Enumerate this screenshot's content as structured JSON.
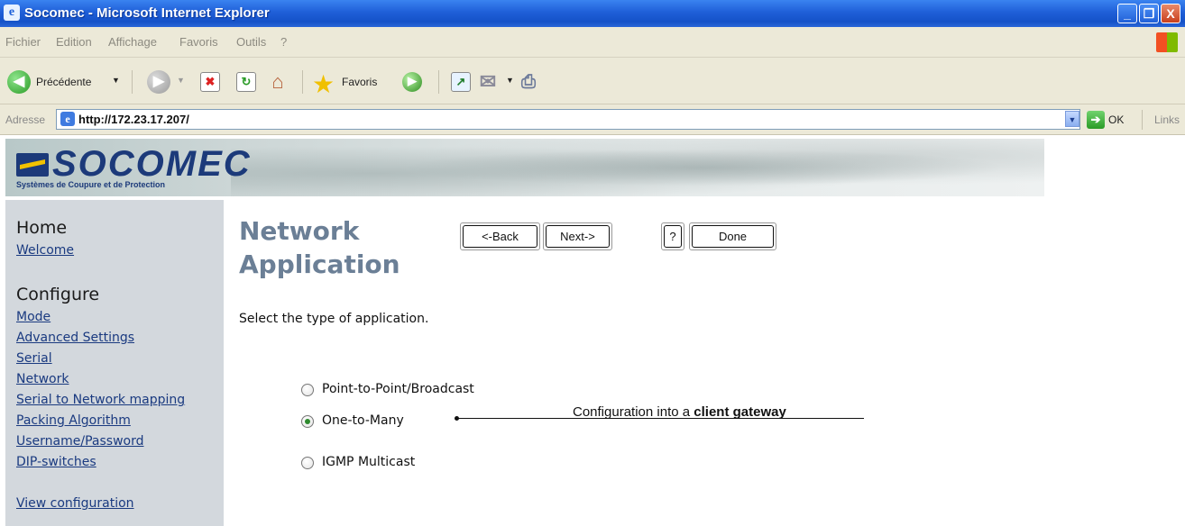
{
  "window": {
    "title": "Socomec - Microsoft Internet Explorer",
    "min_glyph": "_",
    "max_glyph": "❐",
    "close_glyph": "X"
  },
  "menu": [
    "Fichier",
    "Edition",
    "Affichage",
    "Favoris",
    "Outils",
    "?"
  ],
  "toolbar": {
    "back_label": "Précédente",
    "favorites_label": "Favoris",
    "icons": [
      "back-arrow-icon",
      "forward-arrow-icon",
      "stop-icon",
      "refresh-icon",
      "home-icon",
      "favorites-star-icon",
      "media-icon",
      "history-icon",
      "mail-icon",
      "print-icon"
    ]
  },
  "address_bar": {
    "label": "Adresse",
    "url": "http://172.23.17.207/",
    "go_label": "OK",
    "links_label": "Links"
  },
  "banner": {
    "logo_text": "SOCOMEC",
    "tagline": "Systèmes de Coupure et de Protection"
  },
  "sidebar": {
    "home_heading": "Home",
    "welcome_link": "Welcome",
    "configure_heading": "Configure",
    "configure_links": [
      "Mode",
      "Advanced Settings",
      "Serial",
      "Network",
      "Serial to Network mapping",
      "Packing Algorithm",
      "Username/Password",
      "DIP-switches"
    ],
    "view_config_link": "View configuration"
  },
  "main": {
    "title_line1": "Network",
    "title_line2": "Application",
    "back_button": "<-Back",
    "next_button": "Next->",
    "help_button": "?",
    "done_button": "Done",
    "instruction": "Select the type of application.",
    "options": [
      {
        "label": "Point-to-Point/Broadcast",
        "checked": false
      },
      {
        "label": "One-to-Many",
        "checked": true
      },
      {
        "label": "IGMP Multicast",
        "checked": false
      }
    ],
    "callout_prefix": "Configuration into a ",
    "callout_bold": "client gateway"
  },
  "colors": {
    "titlebar": "#1f5fd8",
    "chrome": "#ece9d8",
    "sidebar": "#d3d8dd",
    "title_text": "#6b7f96",
    "link": "#1a3a80",
    "logo": "#1c3a7a"
  }
}
